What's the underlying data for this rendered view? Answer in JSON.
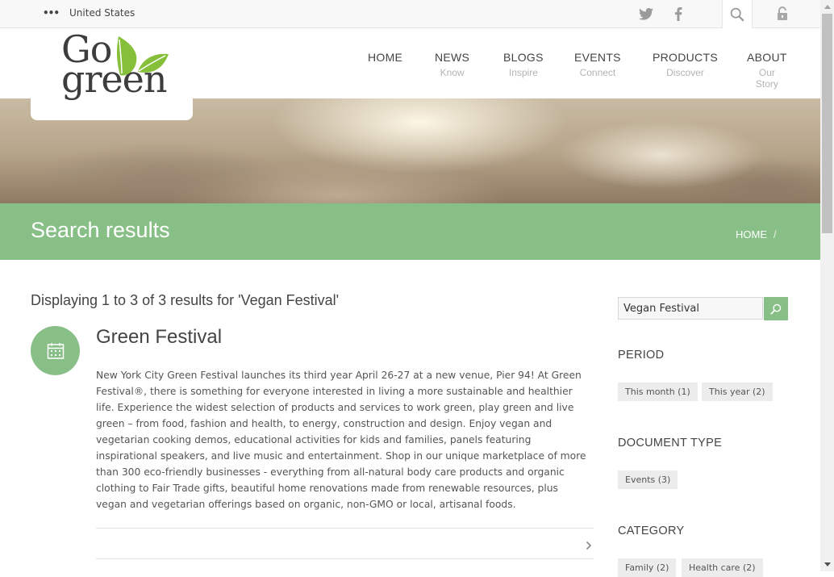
{
  "topbar": {
    "country": "United States",
    "icons": [
      "twitter-icon",
      "facebook-icon",
      "search-icon",
      "lock-icon"
    ]
  },
  "logo": {
    "line1": "Go",
    "line2": "green"
  },
  "nav": [
    {
      "label": "HOME",
      "sub": ""
    },
    {
      "label": "NEWS",
      "sub": "Know"
    },
    {
      "label": "BLOGS",
      "sub": "Inspire"
    },
    {
      "label": "EVENTS",
      "sub": "Connect"
    },
    {
      "label": "PRODUCTS",
      "sub": "Discover"
    },
    {
      "label": "ABOUT",
      "sub": "Our Story"
    }
  ],
  "page": {
    "title": "Search results",
    "breadcrumb": "HOME",
    "breadcrumb_sep": "/"
  },
  "results": {
    "summary": "Displaying 1 to 3 of 3 results for 'Vegan Festival'",
    "items": [
      {
        "title": "Green Festival",
        "icon": "calendar-icon",
        "body": "New York City Green Festival launches its third year April 26-27 at a new venue, Pier 94! At Green Festival®, there is something for everyone interested in living a more sustainable and healthier life. Experience the widest selection of products and services to work green, play green and live green – from food, fashion and health, to energy, construction and design. Enjoy vegan and vegetarian cooking demos, educational activities for kids and families, panels featuring inspirational speakers, and live music and entertainment. Shop in our unique marketplace of more than 300 eco-friendly businesses - everything from all-natural body care products and organic clothing to Fair Trade gifts, beautiful home renovations made from renewable resources, plus vegan and vegetarian offerings based on organic, non-GMO or local, artisanal foods."
      }
    ]
  },
  "sidebar": {
    "search_value": "Vegan Festival",
    "facets": [
      {
        "heading": "PERIOD",
        "tags": [
          "This month (1)",
          "This year (2)"
        ]
      },
      {
        "heading": "DOCUMENT TYPE",
        "tags": [
          "Events (3)"
        ]
      },
      {
        "heading": "CATEGORY",
        "tags": [
          "Family (2)",
          "Health care (2)"
        ]
      }
    ]
  },
  "colors": {
    "accent": "#88bf87",
    "text": "#555555",
    "heading": "#444444"
  }
}
